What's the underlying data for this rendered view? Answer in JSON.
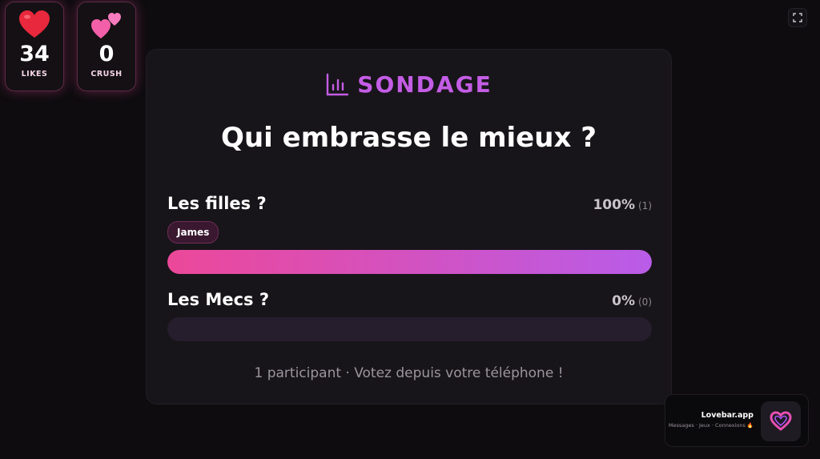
{
  "stats": {
    "likes": {
      "icon": "heart-icon",
      "value": "34",
      "label": "LIKES"
    },
    "crush": {
      "icon": "two-hearts-icon",
      "value": "0",
      "label": "CRUSH"
    }
  },
  "fullscreen": {
    "icon": "fullscreen-icon"
  },
  "poll": {
    "header_icon": "bar-chart-icon",
    "header_title": "SONDAGE",
    "question": "Qui embrasse le mieux ?",
    "options": [
      {
        "label": "Les filles ?",
        "percent_text": "100%",
        "count_text": "(1)",
        "share": 1.0,
        "voters": [
          "James"
        ]
      },
      {
        "label": "Les Mecs ?",
        "percent_text": "0%",
        "count_text": "(0)",
        "share": 0.0,
        "voters": []
      }
    ],
    "footer": "1 participant · Votez depuis votre téléphone !"
  },
  "promo": {
    "title": "Lovebar.app",
    "subtitle": "Messages · Jeux · Connexions 🔥",
    "logo_icon": "heart-outline-icon"
  },
  "colors": {
    "accent": "#c45de6",
    "bar_start": "#ec4899",
    "bar_end": "#b95ce8",
    "bar_track": "#261d2d"
  }
}
